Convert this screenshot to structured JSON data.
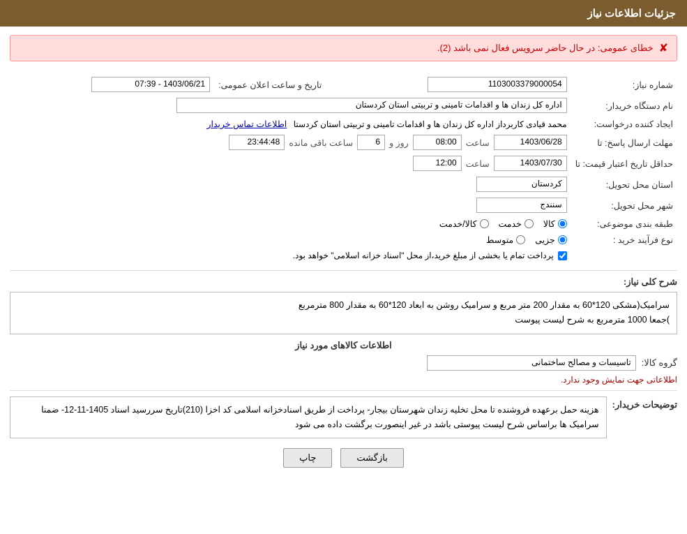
{
  "header": {
    "title": "جزئیات اطلاعات نیاز"
  },
  "error": {
    "message": "خطای عمومی: در حال حاضر سرویس فعال نمی باشد (2)."
  },
  "fields": {
    "shomara_niaz_label": "شماره نیاز:",
    "shomara_niaz_value": "1103003379000054",
    "tarikh_label": "تاریخ و ساعت اعلان عمومی:",
    "tarikh_value": "1403/06/21 - 07:39",
    "nam_dastgah_label": "نام دستگاه خریدار:",
    "nam_dastgah_value": "اداره کل زندان ها و اقدامات تامینی و تربیتی استان کردستان",
    "ijad_label": "ایجاد کننده درخواست:",
    "ijad_value": "محمد  قیادی کاربرداز اداره کل زندان ها و اقدامات تامینی و تربیتی استان کردستا",
    "ijad_link": "اطلاعات تماس خریدار",
    "mohlat_label": "مهلت ارسال پاسخ: تا",
    "mohlat_date": "1403/06/28",
    "mohlat_saat_label": "ساعت",
    "mohlat_saat_value": "08:00",
    "mohlat_roz_label": "روز و",
    "mohlat_roz_value": "6",
    "mohlat_remaining_label": "ساعت باقی مانده",
    "mohlat_remaining_value": "23:44:48",
    "hadadaghal_label": "حداقل تاریخ اعتبار قیمت: تا",
    "hadadaghal_date": "1403/07/30",
    "hadadaghal_saat_label": "ساعت",
    "hadadaghal_saat_value": "12:00",
    "ostan_label": "استان محل تحویل:",
    "ostan_value": "کردستان",
    "shahr_label": "شهر محل تحویل:",
    "shahr_value": "سنندج",
    "tabagheh_label": "طبقه بندی موضوعی:",
    "tabagheh_options": [
      "کالا",
      "خدمت",
      "کالا/خدمت"
    ],
    "tabagheh_selected": "کالا",
    "noع_label": "نوع فرآیند خرید :",
    "noع_options": [
      "جزیی",
      "متوسط"
    ],
    "noع_selected": "جزیی",
    "checkbox_label": "پرداخت تمام یا بخشی از مبلغ خرید،از محل \"اسناد خزانه اسلامی\" خواهد بود.",
    "checkbox_checked": true,
    "sharch_label": "شرح کلی نیاز:",
    "sharch_value": "سرامیک(مشکی  120*60  به مقدار 200 متر مربع  و  سرامیک روشن به ابعاد 120*60 به مقدار 800 مترمربع\n)جمعا 1000 مترمربع به شرح لیست پیوست",
    "kalaha_section": "اطلاعات کالاهای مورد نیاز",
    "gorohe_kala_label": "گروه کالا:",
    "gorohe_kala_value": "تاسیسات و مصالح ساختمانی",
    "no_info": "اطلاعاتی جهت نمایش وجود ندارد.",
    "towzih_label": "توضیحات خریدار:",
    "towzih_value": "هزینه حمل برعهده فروشنده  تا محل  تخلیه  زندان  شهرستان بیجار- پرداخت از طریق اسنادخزانه اسلامی کد اخزا (210)تاریخ سررسید اسناد 1405-11-12- ضمنا سرامیک ها براساس شرح لیست پیوستی باشد در غیر اینصورت برگشت داده می شود",
    "btn_print": "چاپ",
    "btn_back": "بازگشت"
  }
}
